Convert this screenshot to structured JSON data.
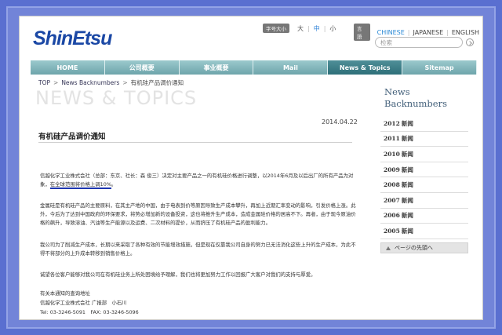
{
  "header": {
    "logo": "ShinEtsu",
    "size_tag": "字号大小",
    "sizes": [
      "大",
      "中",
      "小"
    ],
    "lang_tag": "言語",
    "languages": [
      "CHINESE",
      "JAPANESE",
      "ENGLISH"
    ],
    "search_placeholder": "检索"
  },
  "nav": [
    "HOME",
    "公司概要",
    "事业概要",
    "Mail",
    "News & Topics",
    "Sitemap"
  ],
  "breadcrumb": [
    "TOP",
    "News Backnumbers",
    "有机硅产品调价通知"
  ],
  "banner": "NEWS & TOPICS",
  "article": {
    "date": "2014.04.22",
    "title": "有机硅产品调价通知",
    "p1_a": "信越化学工业株式会社（总部：东京、社长：森 俊三）决定对主要产品之一的有机硅价格进行调整，以2014年6月及以后出厂的所有产品为对象，",
    "p1_hl": "在全球范围将价格上调10%",
    "p1_b": "。",
    "p2": "金属硅是有机硅产品的主要原料，在其主产地的中国，由于电表到价等原因导致生产成本攀升，再加上近期汇率变动的影响，引发价格上涨。此外，今后为了达到中国政府的环保要求，将势必增加新的设备投资，这也将推升生产成本，造成金属硅价格的居高不下。再者，由于现今原油价格的飙升，导致溶油、汽油等生产能源以及运费、二次材料的提价，从而挤压了有机硅产品的盈利能力。",
    "p3": "我公司为了削减生产成本，长期以来采取了各种有效的节能增效措施，但是现在仅靠我公司自身的努力已无法消化这些上升的生产成本，为此不得不将部分的上升成本转移到销售价格上。",
    "p4": "诚望各位客户能够对我公司在有机硅业务上所处困境给予理解，我们也将更加努力工作以回报广大客户对我们的支持与厚爱。"
  },
  "contact": {
    "label": "有关本通知的查询地址",
    "company": "信越化学工业株式会社 广报部　小石川",
    "phone": "Tel: 03-3246-5091　FAX: 03-3246-5096"
  },
  "sidebar": {
    "title_line1": "News",
    "title_line2": "Backnumbers",
    "years": [
      {
        "year": "2012",
        "label": "新闻"
      },
      {
        "year": "2011",
        "label": "新闻"
      },
      {
        "year": "2010",
        "label": "新闻"
      },
      {
        "year": "2009",
        "label": "新闻"
      },
      {
        "year": "2008",
        "label": "新闻"
      },
      {
        "year": "2007",
        "label": "新闻"
      },
      {
        "year": "2006",
        "label": "新闻"
      },
      {
        "year": "2005",
        "label": "新闻"
      }
    ],
    "back_to_top": "ページの先頭へ"
  }
}
